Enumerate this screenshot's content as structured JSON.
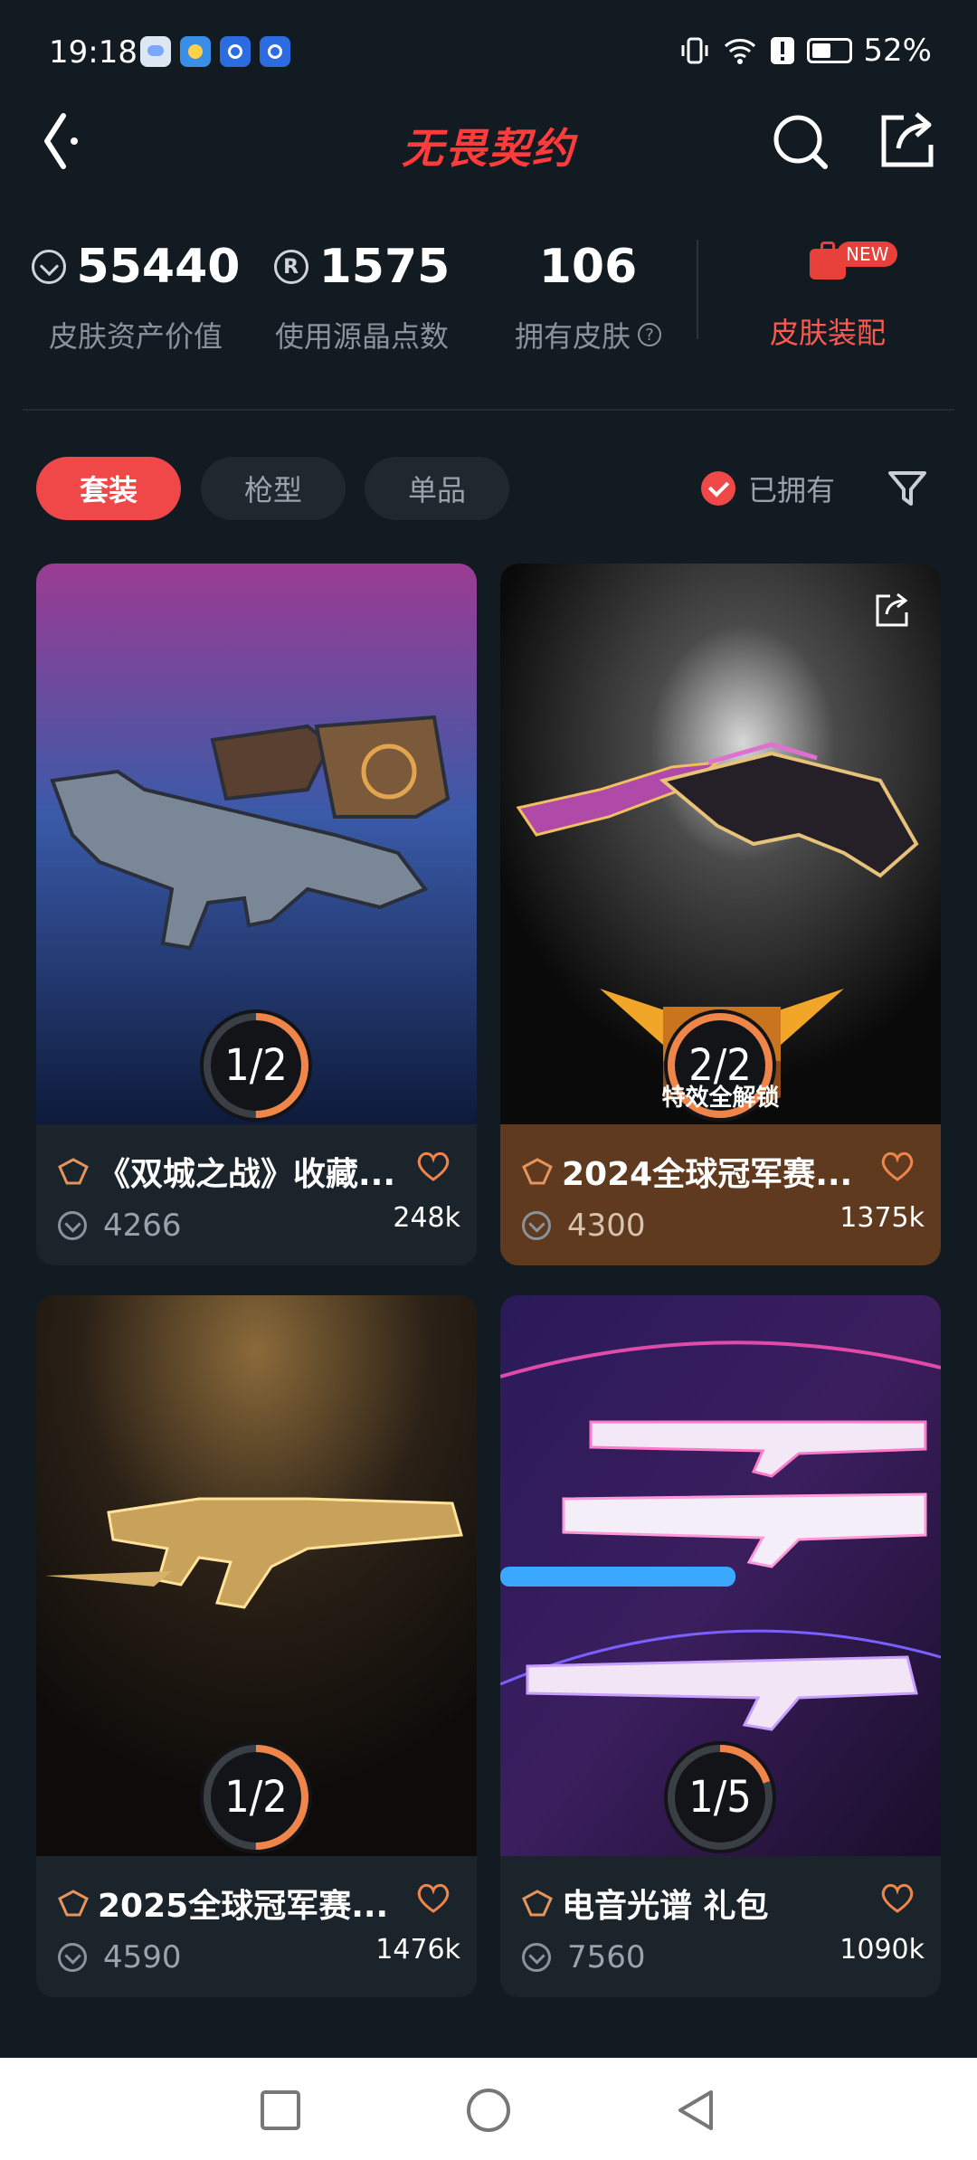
{
  "status_bar": {
    "time": "19:18",
    "battery": "52%",
    "battery_level": 0.52
  },
  "nav": {
    "title": "无畏契约"
  },
  "stats": {
    "asset_value": "55440",
    "asset_label": "皮肤资产价值",
    "radianite": "1575",
    "radianite_label": "使用源晶点数",
    "skins_owned": "106",
    "skins_label": "拥有皮肤",
    "equip_label": "皮肤装配",
    "equip_badge": "NEW"
  },
  "filters": {
    "tabs": [
      {
        "label": "套装",
        "active": true
      },
      {
        "label": "枪型",
        "active": false
      },
      {
        "label": "单品",
        "active": false
      }
    ],
    "owned_label": "已拥有"
  },
  "cards": [
    {
      "title": "《双城之战》收藏...",
      "price": "4266",
      "likes": "248k",
      "progress": "1/2",
      "progress_fraction": 0.5
    },
    {
      "title": "2024全球冠军赛...",
      "price": "4300",
      "likes": "1375k",
      "progress": "2/2",
      "progress_fraction": 1.0,
      "badge": "特效全解锁"
    },
    {
      "title": "2025全球冠军赛...",
      "price": "4590",
      "likes": "1476k",
      "progress": "1/2",
      "progress_fraction": 0.5
    },
    {
      "title": "电音光谱 礼包",
      "price": "7560",
      "likes": "1090k",
      "progress": "1/5",
      "progress_fraction": 0.2
    }
  ],
  "colors": {
    "accent": "#f04848",
    "background": "#121a22",
    "card": "#1b232b",
    "progress": "#f0854a"
  }
}
